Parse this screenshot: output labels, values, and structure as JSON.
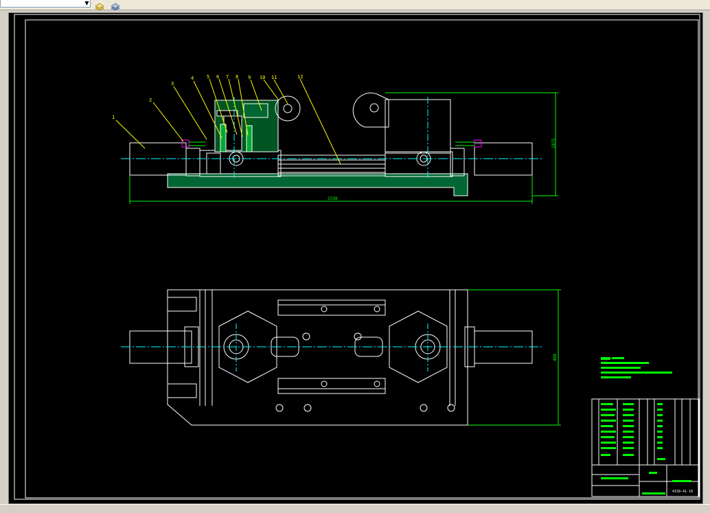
{
  "toolbar": {
    "combo_value": "",
    "icons": [
      "layer-icon",
      "layer-properties-icon"
    ]
  },
  "drawing": {
    "part_labels": [
      "1",
      "2",
      "3",
      "4",
      "5",
      "6",
      "7",
      "8",
      "9",
      "10",
      "11",
      "12"
    ],
    "dim_overall_length": "1538",
    "dim_height_front": "1075",
    "dim_height_top": "488",
    "colors": {
      "background": "#000000",
      "lines": "#ffffff",
      "dimensions": "#00ff00",
      "centerlines": "#00ffff",
      "labels": "#ffff00",
      "hatch": "#00ff00",
      "accent": "#ff00ff"
    }
  },
  "title_block": {
    "drawing_number": "4158-41-10"
  }
}
